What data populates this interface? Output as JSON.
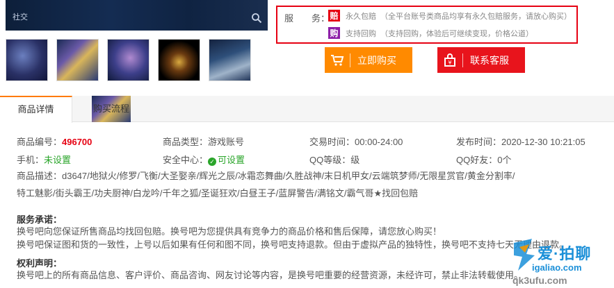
{
  "main_image": {
    "label": "社交"
  },
  "thumbnails": [
    "thumb-1",
    "thumb-2",
    "thumb-3",
    "thumb-4",
    "thumb-5"
  ],
  "service": {
    "label": "服　　务：",
    "rows": [
      {
        "badge": "赔",
        "badge_color": "#e60012",
        "title": "永久包赔",
        "detail": "（全平台账号类商品均享有永久包赔服务，请放心购买）"
      },
      {
        "badge": "购",
        "badge_color": "#8d1fa8",
        "title": "支持回购",
        "detail": "（支持回购，体验后可继续变现，价格公道）"
      }
    ]
  },
  "buttons": {
    "buy": "立即购买",
    "contact": "联系客服"
  },
  "tabs": [
    "商品详情",
    "购买流程"
  ],
  "info": {
    "row1": {
      "code_label": "商品编号：",
      "code_value": "496700",
      "type_label": "商品类型：",
      "type_value": "游戏账号",
      "time_label": "交易时间：",
      "time_value": "00:00-24:00",
      "publish_label": "发布时间：",
      "publish_value": "2020-12-30 10:21:05"
    },
    "row2": {
      "phone_label": "手机：",
      "phone_value": "未设置",
      "security_label": "安全中心：",
      "security_value": "可设置",
      "qqlevel_label": "QQ等级：",
      "qqlevel_value": "级",
      "qqfriends_label": "QQ好友：",
      "qqfriends_value": "0个"
    },
    "description_label": "商品描述：",
    "description_line1": "d3647/地狱火/修罗/飞衡/大圣娶亲/辉光之辰/冰霜恋舞曲/久胜战神/末日机甲女/云端筑梦师/无限星赏官/黄金分割率/",
    "description_line2": "特工魅影/街头霸王/功夫厨神/白龙吟/千年之狐/圣诞狂欢/白昼王子/蓝屏警告/满铭文/霸气哥★找回包赔"
  },
  "service_promise": {
    "title": "服务承诺：",
    "line1": "换号吧向您保证所售商品均找回包赔。换号吧为您提供具有竞争力的商品价格和售后保障，请您放心购买！",
    "line2": "换号吧保证图和货的一致性，上号以后如果有任何和图不同，换号吧支持退款。但由于虚拟产品的独特性，换号吧不支持七天无理由退款。"
  },
  "rights": {
    "title": "权利声明：",
    "line1": "换号吧上的所有商品信息、客户评价、商品咨询、网友讨论等内容，是换号吧重要的经营资源，未经许可，禁止非法转载使用。"
  },
  "watermark": {
    "main": "爱·拍聊",
    "sub": "igaliao.com",
    "sub2": "qk3ufu.com"
  },
  "colors": {
    "accent_orange": "#ff8a00",
    "accent_red": "#e8141c",
    "border_red": "#e60012",
    "ok_green": "#2aa52a"
  }
}
